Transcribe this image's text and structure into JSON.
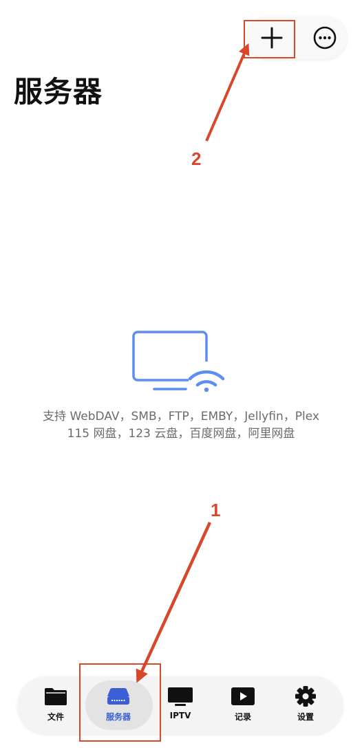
{
  "header": {
    "title": "服务器",
    "add_icon": "plus-icon",
    "more_icon": "ellipsis-circle-icon"
  },
  "empty_state": {
    "icon": "tv-wifi-icon",
    "line1": "支持 WebDAV，SMB，FTP，EMBY，Jellyfin，Plex",
    "line2": "115 网盘，123 云盘，百度网盘，阿里网盘"
  },
  "annotations": {
    "label_1": "1",
    "label_2": "2",
    "color": "#d9472b"
  },
  "tabs": [
    {
      "label": "文件",
      "icon": "folder-icon",
      "active": false
    },
    {
      "label": "服务器",
      "icon": "server-icon",
      "active": true
    },
    {
      "label": "IPTV",
      "icon": "tv-icon",
      "active": false
    },
    {
      "label": "记录",
      "icon": "play-icon",
      "active": false
    },
    {
      "label": "设置",
      "icon": "gear-icon",
      "active": false
    }
  ],
  "colors": {
    "accent": "#3a5fd6",
    "illustration": "#5b8ef0"
  }
}
